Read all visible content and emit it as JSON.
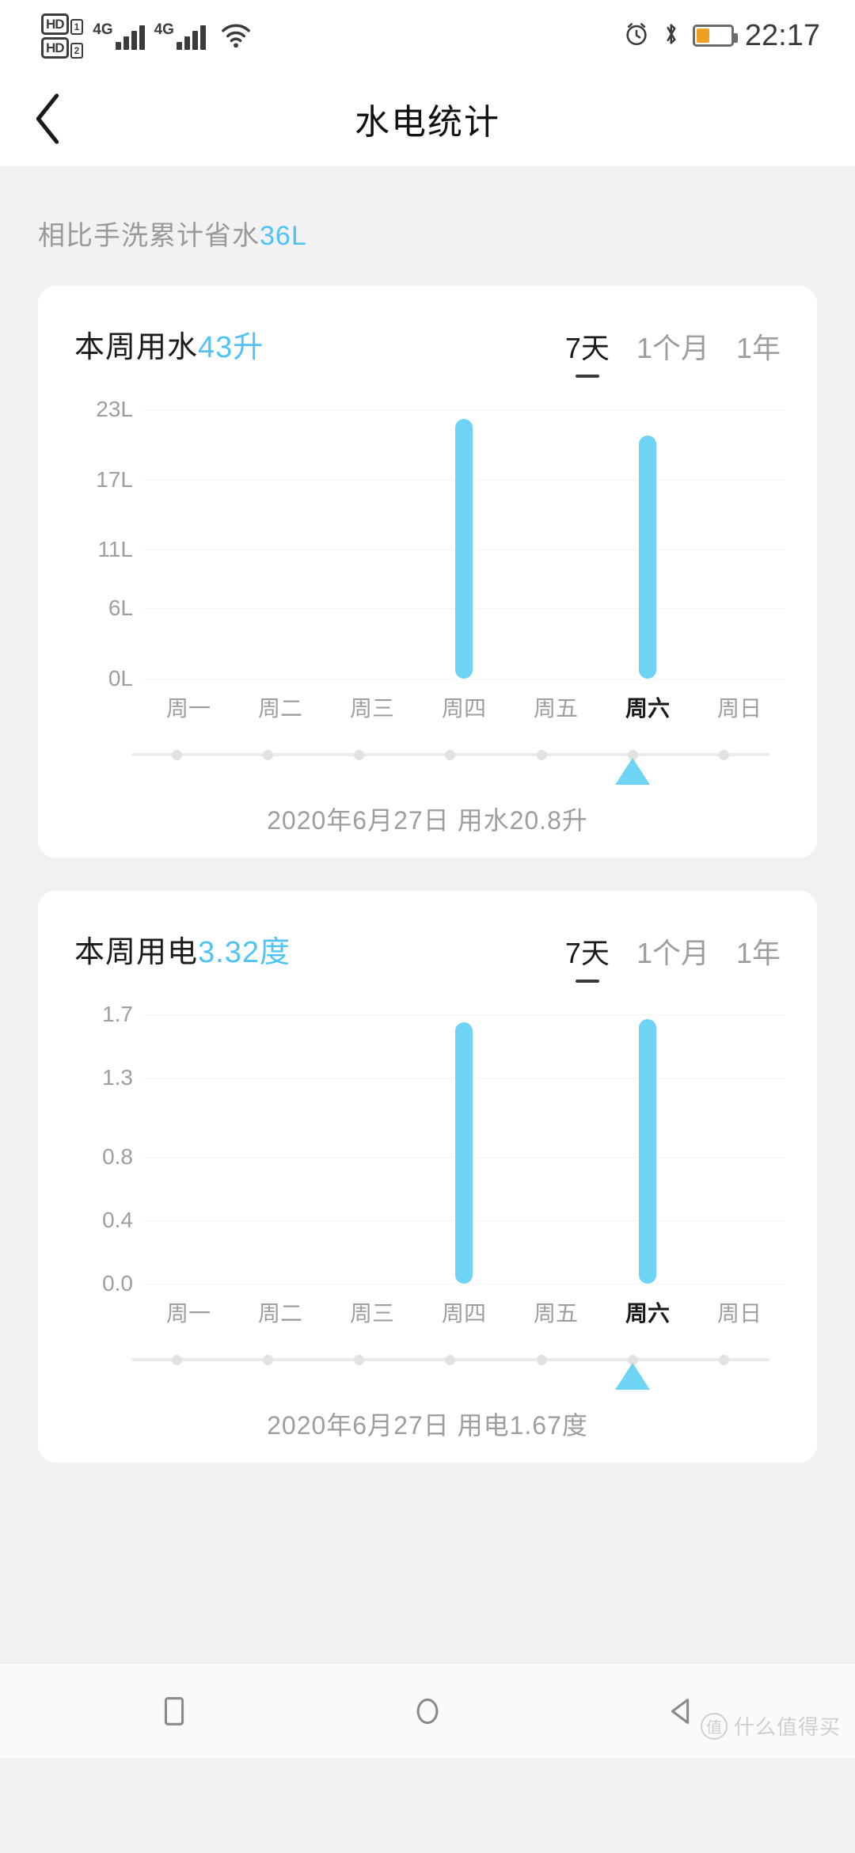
{
  "status_bar": {
    "hd_badge_1": "HD",
    "hd_badge_1_sim": "1",
    "hd_badge_2": "HD",
    "hd_badge_2_sim": "2",
    "network_1": "4G",
    "network_2": "4G",
    "wifi": "wifi-icon",
    "alarm": "alarm-icon",
    "bluetooth": "bluetooth-icon",
    "battery_level": 38,
    "battery_color": "#f0a020",
    "time": "22:17"
  },
  "appbar": {
    "back": "back-chevron-icon",
    "title": "水电统计"
  },
  "summary": {
    "text": "相比手洗累计省水",
    "value": "36L"
  },
  "accent_color": "#4fc3f7",
  "bar_color": "#6fd3f5",
  "cards": [
    {
      "title_text": "本周用水",
      "title_value": "43升",
      "segments": [
        {
          "label": "7天",
          "active": true
        },
        {
          "label": "1个月",
          "active": false
        },
        {
          "label": "1年",
          "active": false
        }
      ],
      "detail": "2020年6月27日 用水20.8升",
      "chart_data": {
        "type": "bar",
        "title": "本周用水43升",
        "categories": [
          "周一",
          "周二",
          "周三",
          "周四",
          "周五",
          "周六",
          "周日"
        ],
        "values": [
          0,
          0,
          0,
          22.2,
          0,
          20.8,
          0
        ],
        "ytick_labels": [
          "23L",
          "17L",
          "11L",
          "6L",
          "0L"
        ],
        "ytick_values": [
          23,
          17,
          11,
          6,
          0
        ],
        "ylim": [
          0,
          23
        ],
        "xlabel": "",
        "ylabel": "",
        "grid": true,
        "selected_index": 5,
        "legend": "none",
        "unit": "L"
      }
    },
    {
      "title_text": "本周用电",
      "title_value": "3.32度",
      "segments": [
        {
          "label": "7天",
          "active": true
        },
        {
          "label": "1个月",
          "active": false
        },
        {
          "label": "1年",
          "active": false
        }
      ],
      "detail": "2020年6月27日 用电1.67度",
      "chart_data": {
        "type": "bar",
        "title": "本周用电3.32度",
        "categories": [
          "周一",
          "周二",
          "周三",
          "周四",
          "周五",
          "周六",
          "周日"
        ],
        "values": [
          0,
          0,
          0,
          1.65,
          0,
          1.67,
          0
        ],
        "ytick_labels": [
          "1.7",
          "1.3",
          "0.8",
          "0.4",
          "0.0"
        ],
        "ytick_values": [
          1.7,
          1.3,
          0.8,
          0.4,
          0.0
        ],
        "ylim": [
          0,
          1.7
        ],
        "xlabel": "",
        "ylabel": "",
        "grid": true,
        "selected_index": 5,
        "legend": "none",
        "unit": "度"
      }
    }
  ],
  "navbar": {
    "recents": "square-icon",
    "home": "circle-icon",
    "back": "triangle-back-icon"
  },
  "watermark": {
    "mark": "值",
    "text": "什么值得买"
  }
}
